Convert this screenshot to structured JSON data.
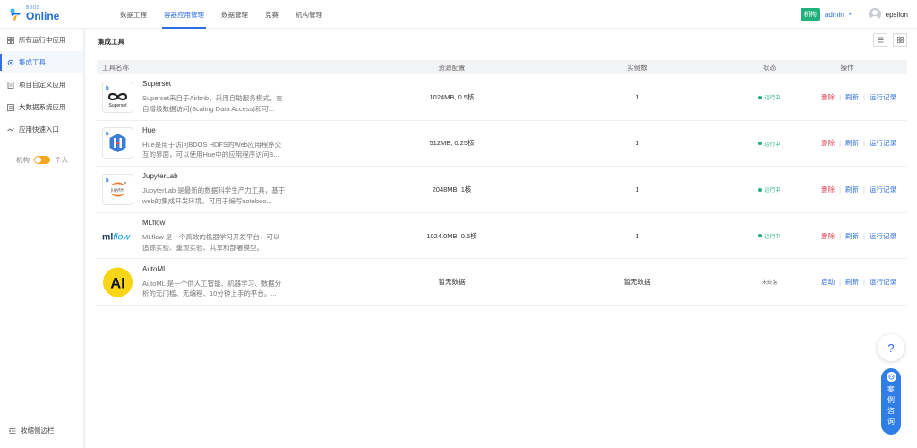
{
  "header": {
    "logo_small": "BDOS",
    "logo_big": "Online",
    "nav": [
      {
        "label": "数据工程"
      },
      {
        "label": "容器应用管理"
      },
      {
        "label": "数据管理"
      },
      {
        "label": "竞赛"
      },
      {
        "label": "机构管理"
      }
    ],
    "active_nav_index": 1,
    "org_badge": "机构",
    "admin_label": "admin",
    "username": "epsilon"
  },
  "sidebar": {
    "items": [
      {
        "label": "所有运行中应用",
        "icon": "grid-icon"
      },
      {
        "label": "集成工具",
        "icon": "gear-icon"
      },
      {
        "label": "项目自定义应用",
        "icon": "doc-icon"
      },
      {
        "label": "大数据系统应用",
        "icon": "list-icon"
      },
      {
        "label": "应用快速入口",
        "icon": "quick-icon"
      }
    ],
    "active_index": 1,
    "toggle_left": "机构",
    "toggle_right": "个人",
    "collapse_label": "收缩侧边栏"
  },
  "main": {
    "title": "集成工具",
    "columns": [
      "工具名称",
      "资源配置",
      "实例数",
      "状态",
      "操作"
    ],
    "rows": [
      {
        "name": "Superset",
        "desc": "Superset来自于Airbnb，采用自助服务模式，在自增级数据访问(Scaling Data Access)和可...",
        "resource": "1024MB, 0.5核",
        "instances": "1",
        "status": "运行中",
        "status_type": "running",
        "ops": [
          "删除",
          "刷新",
          "运行记录"
        ]
      },
      {
        "name": "Hue",
        "desc": "Hue是用于访问BDOS HDFS的Web应用程序交互的界面，可以使用Hue中的应用程序访问B...",
        "resource": "512MB, 0.25核",
        "instances": "1",
        "status": "运行中",
        "status_type": "running",
        "ops": [
          "删除",
          "刷新",
          "运行记录"
        ]
      },
      {
        "name": "JupyterLab",
        "desc": "JupyterLab 是最新的数据科学生产力工具，基于web的集成开发环境。可用于编写noteboo...",
        "resource": "2048MB, 1核",
        "instances": "1",
        "status": "运行中",
        "status_type": "running",
        "ops": [
          "删除",
          "刷新",
          "运行记录"
        ]
      },
      {
        "name": "MLflow",
        "desc": "MLflow 是一个高效的机器学习开发平台，可以追踪实验、重现实验、共享和部署模型。",
        "resource": "1024.0MB, 0.5核",
        "instances": "1",
        "status": "运行中",
        "status_type": "running",
        "ops": [
          "删除",
          "刷新",
          "运行记录"
        ]
      },
      {
        "name": "AutoML",
        "desc": "AutoML 是一个供人工智能、机器学习、数据分析的无门槛、无编程、10分钟上手的平台。...",
        "resource": "暂无数据",
        "instances": "暂无数据",
        "status": "未安装",
        "status_type": "idle",
        "ops": [
          "启动",
          "刷新",
          "运行记录"
        ]
      }
    ],
    "logo_texts": {
      "superset": "Superset",
      "jupyter": "jupyter",
      "mlflow_ml": "ml",
      "mlflow_flow": "flow",
      "automl": "AI"
    }
  },
  "float": {
    "help": "?",
    "consult_chars": [
      "案",
      "例",
      "咨",
      "询"
    ]
  },
  "colors": {
    "primary": "#2f6fe0",
    "success": "#21b07b",
    "danger": "#e0475a",
    "toggle": "#f5a623"
  }
}
